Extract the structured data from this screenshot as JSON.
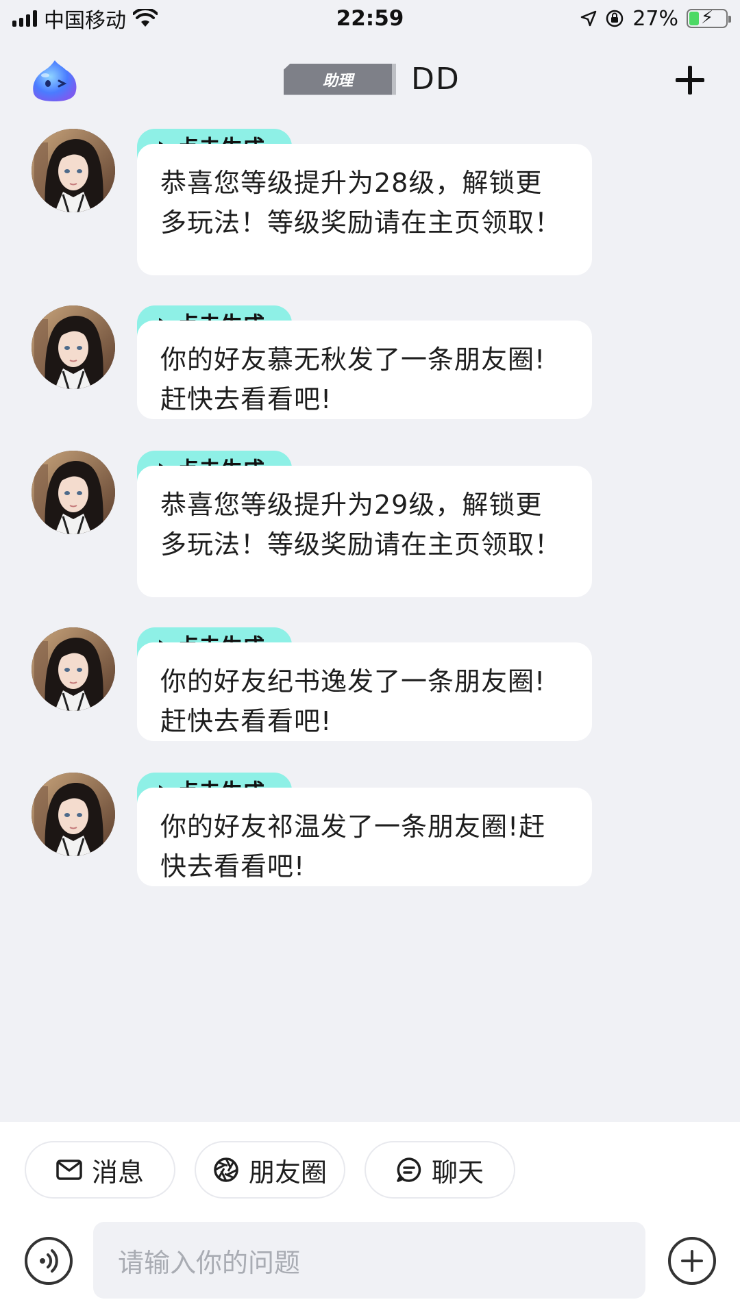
{
  "status_bar": {
    "carrier": "中国移动",
    "time": "22:59",
    "battery": "27%",
    "battery_level": 0.27
  },
  "header": {
    "badge": "助理",
    "title": "DD",
    "icons": [
      "mascot-icon",
      "add-icon"
    ]
  },
  "messages": [
    {
      "tag": "点击生成",
      "text": "恭喜您等级提升为28级，解锁更多玩法！等级奖励请在主页领取！"
    },
    {
      "tag": "点击生成",
      "text": "你的好友慕无秋发了一条朋友圈!赶快去看看吧!"
    },
    {
      "tag": "点击生成",
      "text": "恭喜您等级提升为29级，解锁更多玩法！等级奖励请在主页领取！"
    },
    {
      "tag": "点击生成",
      "text": "你的好友纪书逸发了一条朋友圈!赶快去看看吧!"
    },
    {
      "tag": "点击生成",
      "text": "你的好友祁温发了一条朋友圈!赶快去看看吧!"
    }
  ],
  "quick_actions": [
    {
      "label": "消息",
      "icon": "mail-icon"
    },
    {
      "label": "朋友圈",
      "icon": "aperture-icon"
    },
    {
      "label": "聊天",
      "icon": "chat-icon"
    }
  ],
  "input": {
    "placeholder": "请输入你的问题"
  },
  "colors": {
    "background": "#f0f1f5",
    "tag": "#8ef0e6",
    "badge": "#7e8088"
  }
}
